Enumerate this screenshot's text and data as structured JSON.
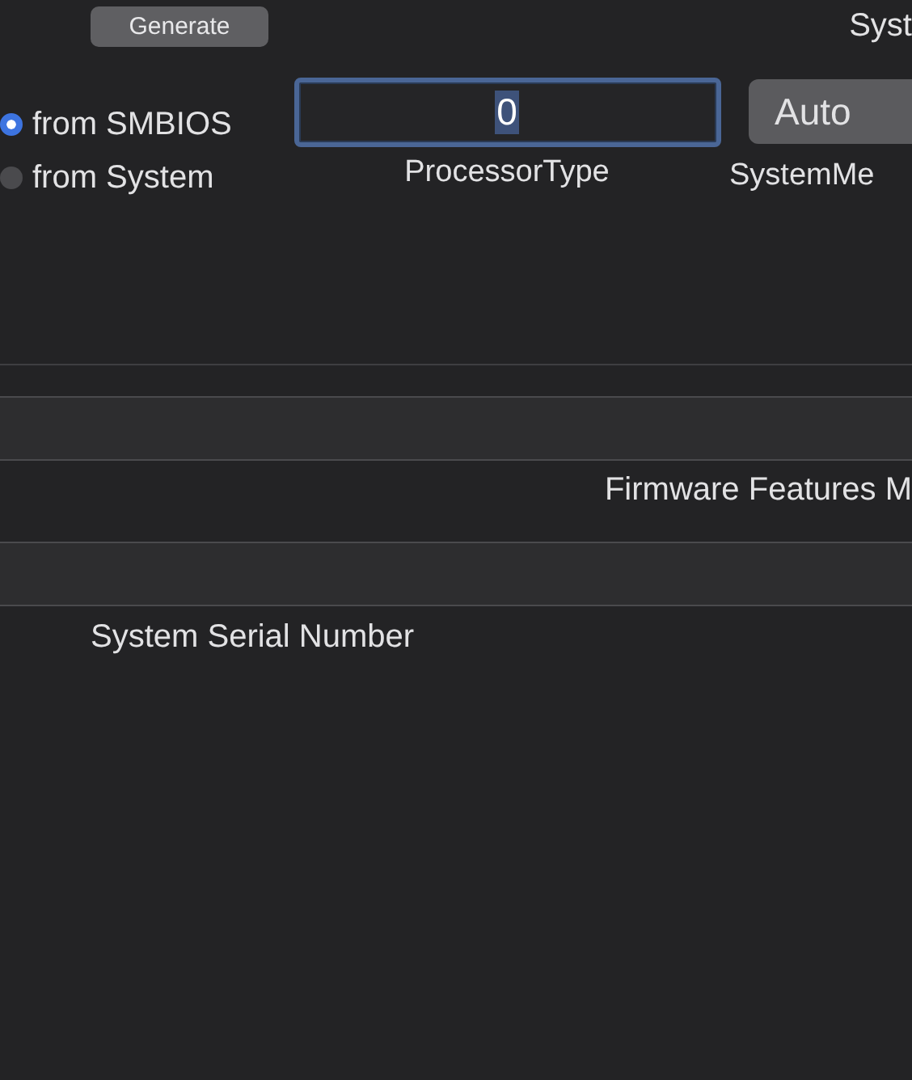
{
  "generate_button": "Generate",
  "header_label": "Syst",
  "source_options": [
    {
      "label": "from SMBIOS",
      "selected": true
    },
    {
      "label": "from System",
      "selected": false
    }
  ],
  "processor_type": {
    "value": "0",
    "label": "ProcessorType",
    "focused": true
  },
  "system_memory": {
    "value": "Auto",
    "label": "SystemMe"
  },
  "firmware_features_label": "Firmware Features M",
  "serial_label": "System Serial Number"
}
